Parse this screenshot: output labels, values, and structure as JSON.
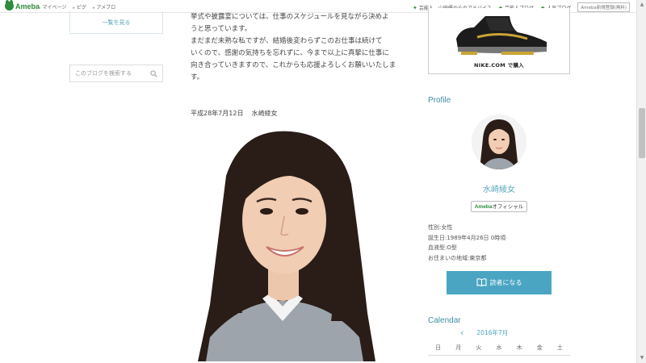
{
  "topbar": {
    "logo": "Ameba",
    "nav": [
      "マイページ",
      "ピグ",
      "アメブロ"
    ],
    "right_links": [
      "芸能人、山田優からのアドバイス",
      "芸能人ブログ",
      "人気ブログ"
    ],
    "register": "Ameba新規登録(無料)"
  },
  "sidebar_left": {
    "list_button": "一覧を見る",
    "search_placeholder": "このブログを検索する"
  },
  "article": {
    "lines": [
      "挙式や披露宴については、仕事のスケジュールを見ながら決めよ",
      "うと思っています。",
      "まだまだ未熟な私ですが、結婚後変わらずこのお仕事は続けて",
      "いくので、感謝の気持ちを忘れずに、今まで以上に真摯に仕事に",
      "向き合っていきますので、これからも応援よろしくお願いいたしま",
      "す。"
    ],
    "date": "平成28年7月12日",
    "author": "水崎綾女"
  },
  "ad": {
    "caption": "NIKE.COM で購入"
  },
  "profile": {
    "heading": "Profile",
    "name": "水崎綾女",
    "official_brand": "Ameba",
    "official_label": "オフィシャル",
    "info": [
      "性別:女性",
      "誕生日:1989年4月26日 0時頃",
      "血液型:O型",
      "お住まいの地域:東京都"
    ],
    "reader_button": "読者になる"
  },
  "calendar": {
    "heading": "Calendar",
    "month": "2016年7月",
    "weekdays": [
      "日",
      "月",
      "火",
      "水",
      "木",
      "金",
      "土"
    ]
  },
  "colors": {
    "accent": "#4aa5c2",
    "ameba_green": "#2d8c3c"
  }
}
